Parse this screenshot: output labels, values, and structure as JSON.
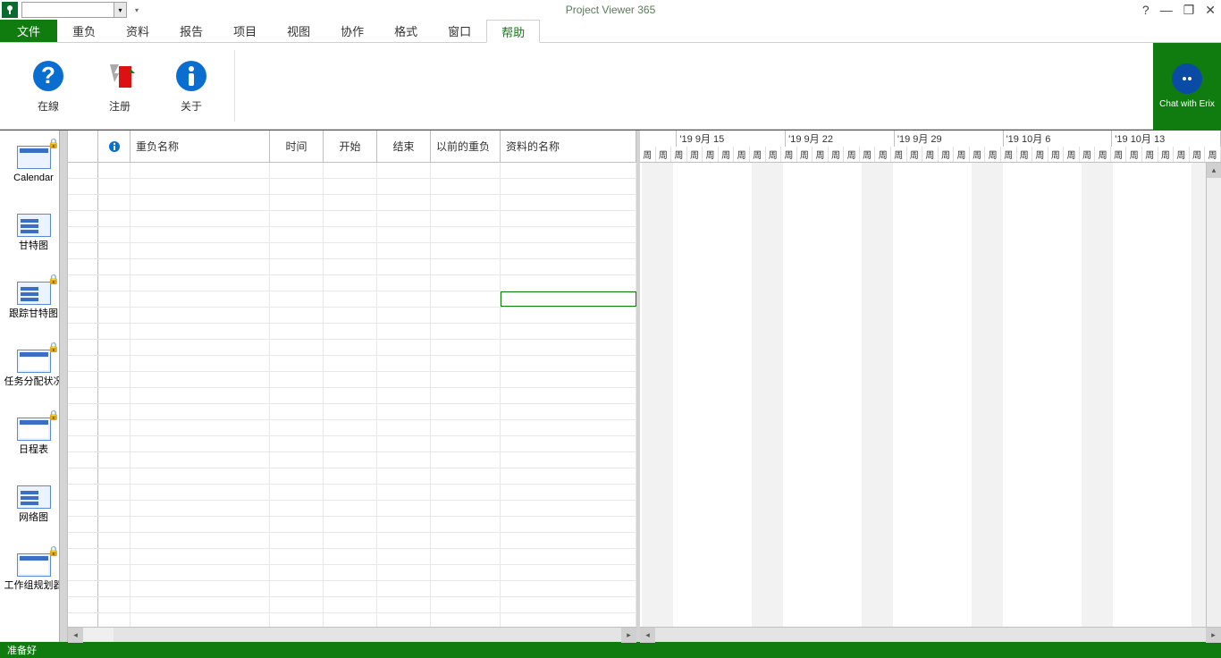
{
  "titlebar": {
    "app_title": "Project Viewer 365",
    "help_tip": "?",
    "minimize": "—",
    "maximize": "❐",
    "close": "✕"
  },
  "tabs": {
    "file": "文件",
    "items": [
      "重负",
      "资料",
      "报告",
      "项目",
      "视图",
      "协作",
      "格式",
      "窗口",
      "帮助"
    ],
    "active_index": 8
  },
  "ribbon": {
    "online": "在線",
    "register": "注册",
    "about": "关于",
    "chat": "Chat with Erix"
  },
  "sideviews": [
    {
      "label": "Calendar",
      "locked": true,
      "icon": "cal"
    },
    {
      "label": "甘特图",
      "locked": false,
      "icon": "gantt"
    },
    {
      "label": "跟踪甘特图",
      "locked": true,
      "icon": "gantt"
    },
    {
      "label": "任务分配状况",
      "locked": true,
      "icon": "table"
    },
    {
      "label": "日程表",
      "locked": true,
      "icon": "table"
    },
    {
      "label": "网络图",
      "locked": false,
      "icon": "gantt"
    },
    {
      "label": "工作组规划器",
      "locked": true,
      "icon": "table"
    }
  ],
  "grid": {
    "columns": {
      "info": "ℹ",
      "name": "重负名称",
      "duration": "时间",
      "start": "开始",
      "finish": "结束",
      "predecessors": "以前的重负",
      "resources": "资料的名称"
    },
    "selected_row": 8,
    "selected_col": "res",
    "row_count": 29
  },
  "timeline": {
    "weeks": [
      "",
      "'19 9月 15",
      "'19 9月 22",
      "'19 9月 29",
      "'19 10月 6",
      "'19 10月 13"
    ],
    "day_label": "周",
    "days_per_week": 7
  },
  "statusbar": {
    "ready": "准备好"
  },
  "colors": {
    "brand": "#107c10",
    "accent_blue": "#0a4ba6"
  }
}
